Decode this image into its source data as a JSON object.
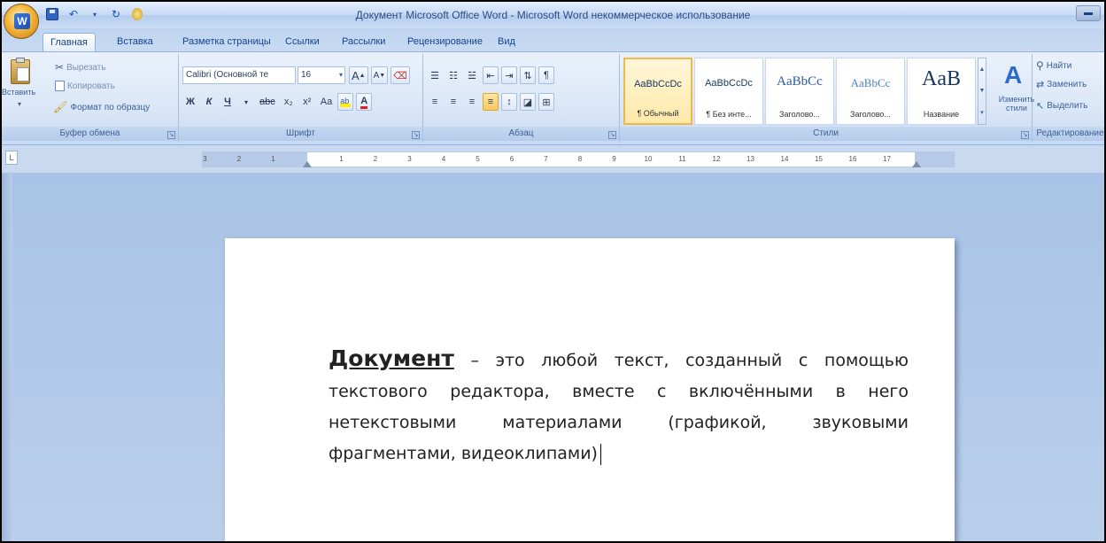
{
  "window": {
    "title": "Документ Microsoft Office Word - Microsoft Word некоммерческое использование"
  },
  "tabs": [
    "Главная",
    "Вставка",
    "Разметка страницы",
    "Ссылки",
    "Рассылки",
    "Рецензирование",
    "Вид"
  ],
  "ribbon": {
    "clipboard": {
      "paste_label": "Вставить",
      "cut_label": "Вырезать",
      "copy_label": "Копировать",
      "format_painter_label": "Формат по образцу",
      "group_label": "Буфер обмена"
    },
    "font": {
      "font_name": "Calibri (Основной те",
      "font_size": "16",
      "group_label": "Шрифт",
      "bold": "Ж",
      "italic": "К",
      "underline": "Ч",
      "strikethrough": "abc",
      "subscript": "x₂",
      "superscript": "x²",
      "change_case": "Aa",
      "grow_font": "A",
      "shrink_font": "A"
    },
    "paragraph": {
      "group_label": "Абзац"
    },
    "styles": {
      "group_label": "Стили",
      "items": [
        {
          "sample": "AaBbCcDc",
          "name": "¶ Обычный"
        },
        {
          "sample": "AaBbCcDc",
          "name": "¶ Без инте..."
        },
        {
          "sample": "AaBbCc",
          "name": "Заголово..."
        },
        {
          "sample": "AaBbCc",
          "name": "Заголово..."
        },
        {
          "sample": "AaB",
          "name": "Название"
        }
      ],
      "change_styles_label": "Изменить стили"
    },
    "editing": {
      "group_label": "Редактирование",
      "find_label": "Найти",
      "replace_label": "Заменить",
      "select_label": "Выделить"
    }
  },
  "ruler": {
    "labels": [
      "3",
      "2",
      "1",
      "1",
      "2",
      "3",
      "4",
      "5",
      "6",
      "7",
      "8",
      "9",
      "10",
      "11",
      "12",
      "13",
      "14",
      "15",
      "16",
      "17"
    ]
  },
  "document": {
    "term": "Документ",
    "body": " – это любой  текст, созданный с помощью текстового редактора, вместе с включёнными в него нетекстовыми материалами (графикой, звуковыми фрагментами, видеоклипами)"
  },
  "colors": {
    "accent": "#15428b",
    "ribbon_bg": "#dbe7f7",
    "workspace_bg": "#a9c3e6",
    "font_color_red": "#e02020",
    "highlight_yellow": "#ffee00"
  }
}
